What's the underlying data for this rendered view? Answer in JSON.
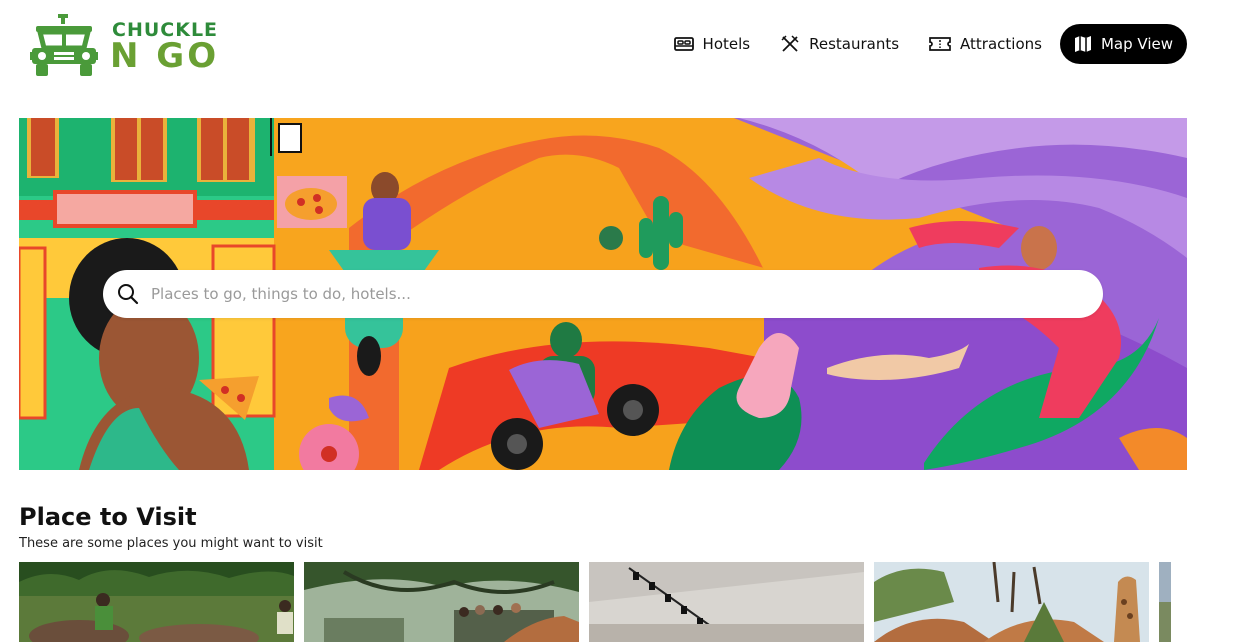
{
  "brand": {
    "line1": "CHUCKLE",
    "line2": "N GO",
    "primary_color": "#2e8b3a",
    "secondary_color": "#6aa033"
  },
  "nav": {
    "items": [
      {
        "label": "Hotels",
        "icon": "bed-icon"
      },
      {
        "label": "Restaurants",
        "icon": "utensils-icon"
      },
      {
        "label": "Attractions",
        "icon": "ticket-icon"
      },
      {
        "label": "Map View",
        "icon": "map-icon"
      }
    ]
  },
  "search": {
    "placeholder": "Places to go, things to do, hotels..."
  },
  "section": {
    "title": "Place to Visit",
    "subtitle": "These are some places you might want to visit"
  }
}
